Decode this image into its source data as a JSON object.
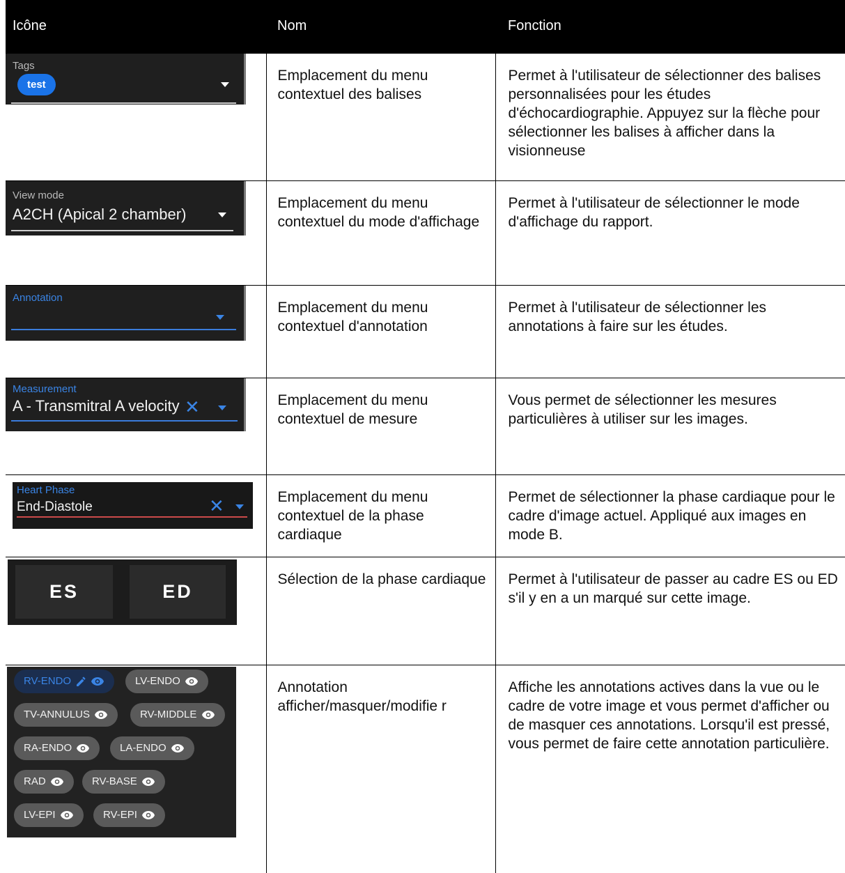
{
  "headers": {
    "icon": "Icône",
    "name": "Nom",
    "function": "Fonction"
  },
  "rows": [
    {
      "widget": {
        "label": "Tags",
        "chip": "test"
      },
      "name": "Emplacement du menu contextuel des balises",
      "function": "Permet à l'utilisateur de sélectionner des balises personnalisées pour les études d'échocardiographie. Appuyez sur la flèche pour sélectionner les balises à afficher dans la visionneuse"
    },
    {
      "widget": {
        "label": "View mode",
        "value": "A2CH (Apical 2 chamber)"
      },
      "name": "Emplacement du menu contextuel du mode d'affichage",
      "function": "Permet à l'utilisateur de sélectionner le mode d'affichage du rapport."
    },
    {
      "widget": {
        "label": "Annotation"
      },
      "name": "Emplacement du menu contextuel d'annotation",
      "function": "Permet à l'utilisateur de sélectionner les annotations à faire sur les études."
    },
    {
      "widget": {
        "label": "Measurement",
        "value": "A - Transmitral A velocity"
      },
      "name": "Emplacement du menu contextuel de mesure",
      "function": "Vous permet de sélectionner les mesures particulières à utiliser sur les images."
    },
    {
      "widget": {
        "label": "Heart Phase",
        "value": "End-Diastole"
      },
      "name": "Emplacement du menu contextuel de la phase cardiaque",
      "function": "Permet de sélectionner la phase cardiaque pour le cadre d'image actuel. Appliqué aux images en mode B."
    },
    {
      "widget": {
        "buttons": [
          "ES",
          "ED"
        ]
      },
      "name": "Sélection de la phase cardiaque",
      "function": "Permet à l'utilisateur de passer au cadre ES ou ED s'il y en a un marqué sur cette image."
    },
    {
      "widget": {
        "pills": [
          "RV-ENDO",
          "LV-ENDO",
          "TV-ANNULUS",
          "RV-MIDDLE",
          "RA-ENDO",
          "LA-ENDO",
          "RAD",
          "RV-BASE",
          "LV-EPI",
          "RV-EPI"
        ]
      },
      "name": "Annotation afficher/masquer/modifie r",
      "function": "Affiche les annotations actives dans la vue ou le cadre de votre image et vous permet d'afficher ou de masquer ces annotations. Lorsqu'il est pressé, vous permet de faire cette annotation particulière."
    }
  ],
  "colors": {
    "header_bg": "#000000",
    "accent_blue": "#1a73e8",
    "panel_bg": "#1f1f1f"
  }
}
